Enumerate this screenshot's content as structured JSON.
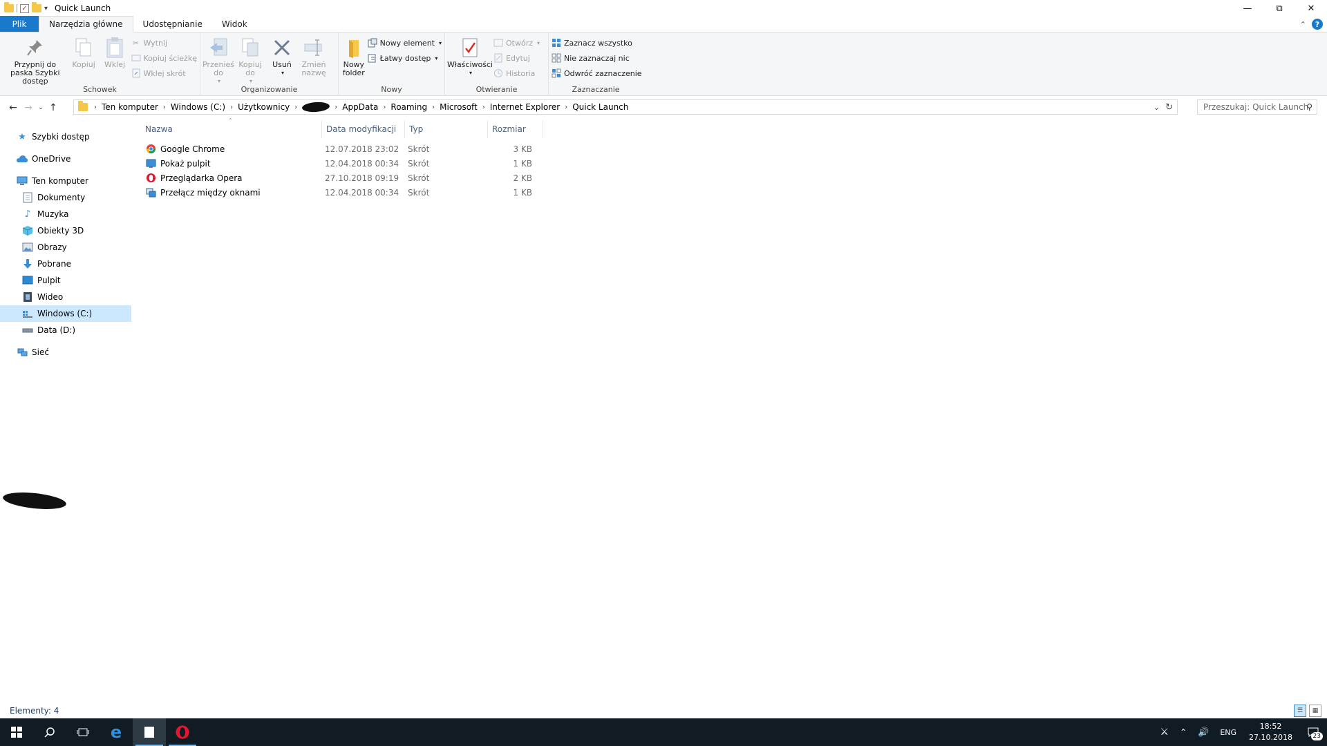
{
  "window": {
    "title": "Quick Launch"
  },
  "tabs": [
    "Plik",
    "Narzędzia główne",
    "Udostępnianie",
    "Widok"
  ],
  "ribbon": {
    "clipboard": {
      "label": "Schowek",
      "pin": "Przypnij do paska Szybki dostęp",
      "copy": "Kopiuj",
      "paste": "Wklej",
      "cut": "Wytnij",
      "copy_path": "Kopiuj ścieżkę",
      "paste_shortcut": "Wklej skrót"
    },
    "organize": {
      "label": "Organizowanie",
      "move_to": "Przenieś do",
      "copy_to": "Kopiuj do",
      "delete": "Usuń",
      "rename": "Zmień nazwę"
    },
    "new": {
      "label": "Nowy",
      "new_folder": "Nowy folder",
      "new_item": "Nowy element",
      "easy_access": "Łatwy dostęp"
    },
    "open": {
      "label": "Otwieranie",
      "properties": "Właściwości",
      "open": "Otwórz",
      "edit": "Edytuj",
      "history": "Historia"
    },
    "select": {
      "label": "Zaznaczanie",
      "select_all": "Zaznacz wszystko",
      "select_none": "Nie zaznaczaj nic",
      "invert": "Odwróć zaznaczenie"
    }
  },
  "address": {
    "crumbs_before": [
      "Ten komputer",
      "Windows (C:)",
      "Użytkownicy"
    ],
    "crumbs_after": [
      "AppData",
      "Roaming",
      "Microsoft",
      "Internet Explorer",
      "Quick Launch"
    ],
    "search_placeholder": "Przeszukaj: Quick Launch"
  },
  "nav": {
    "quick_access": "Szybki dostęp",
    "onedrive": "OneDrive",
    "this_pc": "Ten komputer",
    "documents": "Dokumenty",
    "music": "Muzyka",
    "objects3d": "Obiekty 3D",
    "pictures": "Obrazy",
    "downloads": "Pobrane",
    "desktop": "Pulpit",
    "videos": "Wideo",
    "drive_c": "Windows (C:)",
    "drive_d": "Data (D:)",
    "network": "Sieć"
  },
  "columns": {
    "name": "Nazwa",
    "date": "Data modyfikacji",
    "type": "Typ",
    "size": "Rozmiar"
  },
  "files": [
    {
      "name": "Google Chrome",
      "date": "12.07.2018 23:02",
      "type": "Skrót",
      "size": "3 KB",
      "icon": "chrome-icon"
    },
    {
      "name": "Pokaż pulpit",
      "date": "12.04.2018 00:34",
      "type": "Skrót",
      "size": "1 KB",
      "icon": "show-desktop-icon"
    },
    {
      "name": "Przeglądarka Opera",
      "date": "27.10.2018 09:19",
      "type": "Skrót",
      "size": "2 KB",
      "icon": "opera-icon"
    },
    {
      "name": "Przełącz między oknami",
      "date": "12.04.2018 00:34",
      "type": "Skrót",
      "size": "1 KB",
      "icon": "switch-windows-icon"
    }
  ],
  "status": {
    "items": "Elementy: 4"
  },
  "tray": {
    "lang": "ENG",
    "time": "18:52",
    "date": "27.10.2018",
    "notifications": "23"
  },
  "colors": {
    "accent": "#1979ca",
    "selection": "#cce8ff",
    "taskbar": "#101b24"
  }
}
